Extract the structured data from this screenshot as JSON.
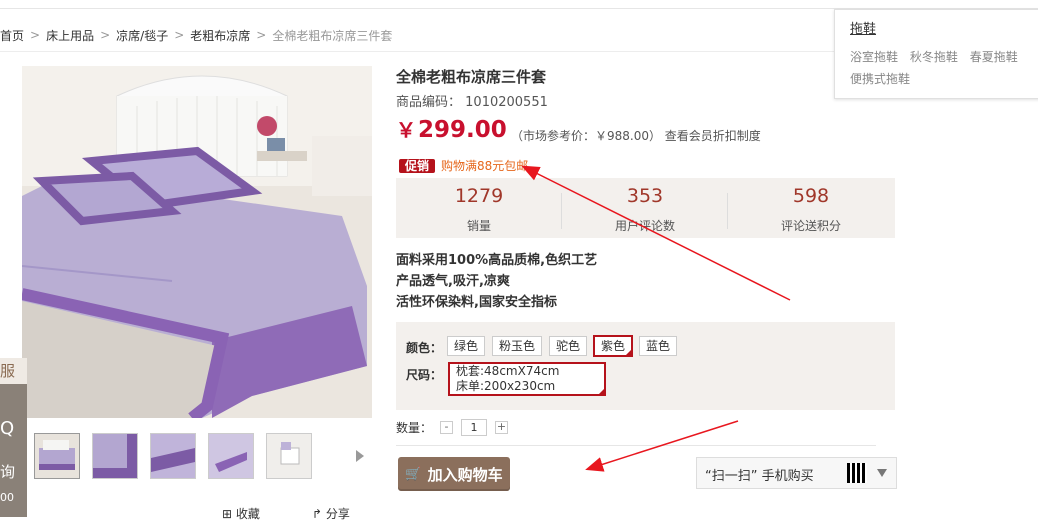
{
  "breadcrumb": {
    "items": [
      "首页",
      "床上用品",
      "凉席/毯子",
      "老粗布凉席"
    ],
    "separator": ">",
    "current": "全棉老粗布凉席三件套"
  },
  "dropdown": {
    "title": "拖鞋",
    "items": [
      "浴室拖鞋",
      "秋冬拖鞋",
      "春夏拖鞋",
      "便携式拖鞋"
    ]
  },
  "product": {
    "title": "全棉老粗布凉席三件套",
    "code_label": "商品编码：",
    "code": "1010200551",
    "price_symbol": "￥",
    "price": "299.00",
    "market_price_text": "（市场参考价：￥988.00） 查看会员折扣制度",
    "promo_tag": "促销",
    "promo_text": "购物满88元包邮"
  },
  "stats": [
    {
      "value": "1279",
      "label": "销量"
    },
    {
      "value": "353",
      "label": "用户评论数"
    },
    {
      "value": "598",
      "label": "评论送积分"
    }
  ],
  "features": [
    "面料采用100%高品质棉,色织工艺",
    "产品透气,吸汗,凉爽",
    "活性环保染料,国家安全指标"
  ],
  "options": {
    "color_label": "颜色：",
    "colors": [
      "绿色",
      "粉玉色",
      "驼色",
      "紫色",
      "蓝色"
    ],
    "selected_color": "紫色",
    "size_label": "尺码：",
    "size_lines": [
      "枕套:48cmX74cm",
      "床单:200x230cm"
    ]
  },
  "quantity": {
    "label": "数量：",
    "value": "1",
    "minus": "-",
    "plus": "+"
  },
  "actions": {
    "cart_label": "加入购物车",
    "scan_label": "“扫一扫” 手机购买",
    "favorite_label": "收藏",
    "share_label": "分享"
  },
  "side_float": {
    "t1": "服",
    "t2": "Q",
    "t3": "询",
    "t4": "00"
  },
  "colors": {
    "accent_red": "#b5121b",
    "price_red": "#c8102e",
    "button_brown": "#8b6f5c",
    "annotation_red": "#e8171f"
  }
}
